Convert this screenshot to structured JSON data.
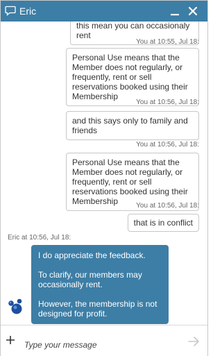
{
  "header": {
    "title": "Eric"
  },
  "messages": [
    {
      "text": "this mean you can occasionaly rent",
      "meta": "You at 10:55, Jul 18:"
    },
    {
      "text": "Personal Use means that the Member does not regularly, or frequently, rent or sell reservations booked using their Membership",
      "meta": "You at 10:56, Jul 18:"
    },
    {
      "text": "and this says only to family and friends",
      "meta": "You at 10:56, Jul 18:"
    },
    {
      "text": "Personal Use means that the Member does not regularly, or frequently, rent or sell reservations booked using their Membership",
      "meta": "You at 10:56, Jul 18:"
    },
    {
      "text": "that is in conflict"
    }
  ],
  "agent_reply": {
    "meta": "Eric at 10:56, Jul 18:",
    "paragraphs": [
      "I do appreciate the feedback.",
      "To clarify, our members may occasionally rent.",
      "However, the membership is not designed for profit."
    ]
  },
  "composer": {
    "placeholder": "Type your message"
  },
  "icons": {
    "header": "chat-bubble-icon",
    "minimize": "minimize-icon",
    "close": "close-icon",
    "avatar": "agent-avatar-icon",
    "attach": "plus-icon",
    "send": "send-arrow-icon"
  },
  "colors": {
    "header_bg": "#3d7ea6",
    "agent_bubble_bg": "#3d7ea6"
  }
}
